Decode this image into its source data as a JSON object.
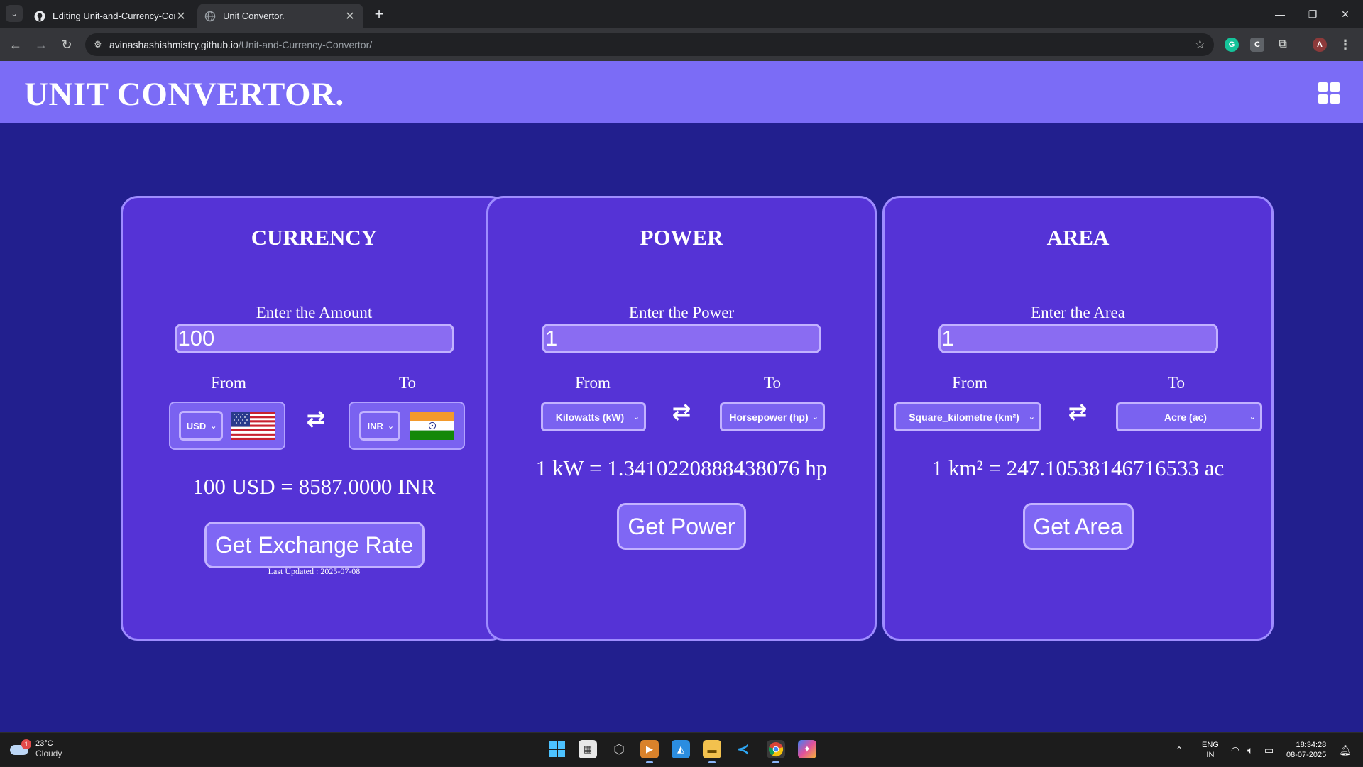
{
  "browser": {
    "tabs": [
      {
        "title": "Editing Unit-and-Currency-Con",
        "active": false,
        "favicon": "github-icon"
      },
      {
        "title": "Unit Convertor.",
        "active": true,
        "favicon": "globe-icon"
      }
    ],
    "url_host": "avinashashishmistry.github.io",
    "url_path": "/Unit-and-Currency-Convertor/",
    "profile_initial": "A"
  },
  "site": {
    "title": "UNIT CONVERTOR.",
    "menu_icon": "grid-icon"
  },
  "currency": {
    "title": "CURRENCY",
    "input_label": "Enter the Amount",
    "amount": "100",
    "from_label": "From",
    "to_label": "To",
    "from_code": "USD",
    "to_code": "INR",
    "result": "100 USD = 8587.0000 INR",
    "button": "Get Exchange Rate",
    "last_updated": "Last Updated : 2025-07-08"
  },
  "power": {
    "title": "POWER",
    "input_label": "Enter the Power",
    "value": "1",
    "from_label": "From",
    "to_label": "To",
    "from_unit": "Kilowatts (kW)",
    "to_unit": "Horsepower (hp)",
    "result": "1 kW = 1.3410220888438076 hp",
    "button": "Get Power"
  },
  "area": {
    "title": "AREA",
    "input_label": "Enter the Area",
    "value": "1",
    "from_label": "From",
    "to_label": "To",
    "from_unit": "Square_kilometre (km²)",
    "to_unit": "Acre (ac)",
    "result": "1 km² = 247.10538146716533 ac",
    "button": "Get Area"
  },
  "taskbar": {
    "weather_temp": "23°C",
    "weather_condition": "Cloudy",
    "weather_badge": "1",
    "language": "ENG",
    "region": "IN",
    "time": "18:34:28",
    "date": "08-07-2025"
  },
  "colors": {
    "page_bg": "#221f8e",
    "header_bg": "#7b6cf6",
    "card_bg": "#5533d6",
    "card_border": "#9e8cff",
    "input_bg": "#8a6cf2"
  }
}
